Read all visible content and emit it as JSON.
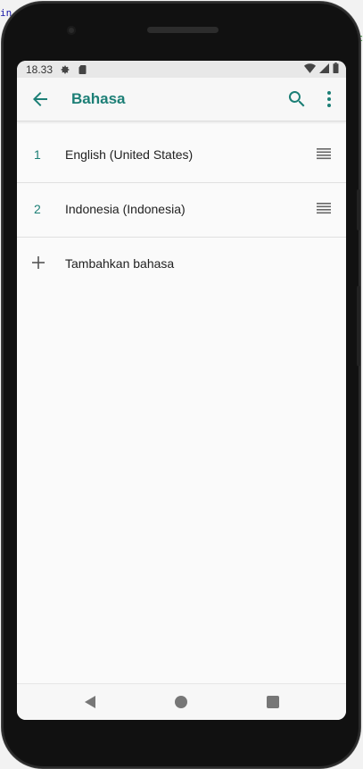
{
  "status": {
    "time": "18.33"
  },
  "appbar": {
    "title": "Bahasa"
  },
  "languages": [
    {
      "num": "1",
      "label": "English (United States)"
    },
    {
      "num": "2",
      "label": "Indonesia (Indonesia)"
    }
  ],
  "add_language": {
    "label": "Tambahkan bahasa"
  },
  "background_text": {
    "left": "in",
    "right": "c"
  },
  "colors": {
    "accent": "#1c7f76",
    "text": "#222222",
    "screen_bg": "#fafafa"
  },
  "icons": [
    "back-arrow-icon",
    "search-icon",
    "more-vert-icon",
    "drag-handle-icon",
    "plus-icon",
    "settings-icon",
    "sd-card-icon",
    "wifi-icon",
    "signal-icon",
    "battery-icon",
    "nav-back-icon",
    "nav-home-icon",
    "nav-recent-icon"
  ]
}
